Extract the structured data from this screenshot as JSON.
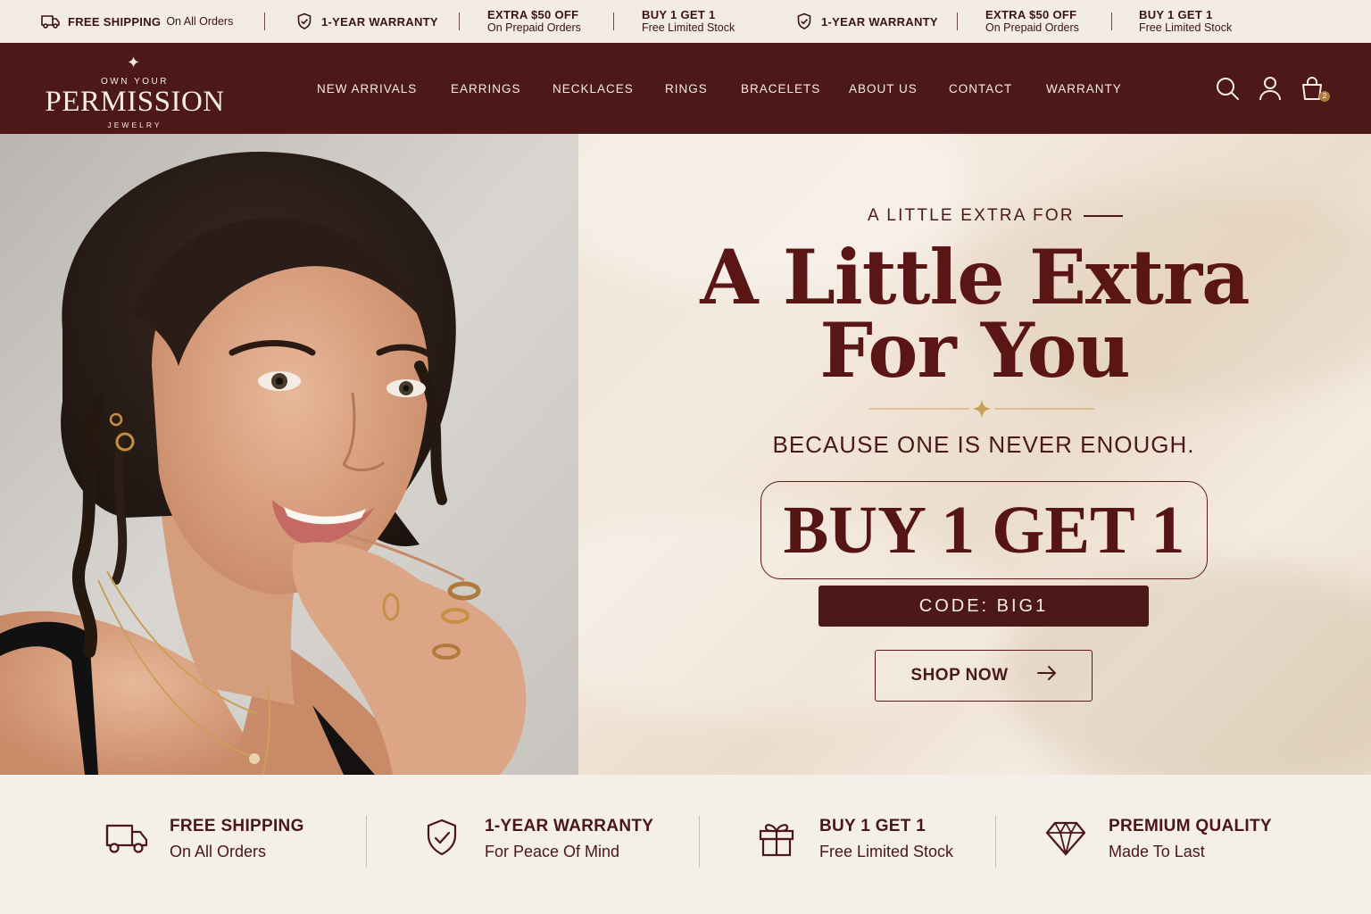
{
  "announcement_bar": {
    "items": [
      {
        "icon": "truck-icon",
        "title": "FREE SHIPPING",
        "sub": "On All Orders"
      },
      {
        "icon": "shield-check-icon",
        "title": "1-YEAR WARRANTY",
        "sub": ""
      },
      {
        "icon": "",
        "title": "EXTRA $50 OFF",
        "sub": "On Prepaid Orders"
      },
      {
        "icon": "",
        "title": "BUY 1 GET 1",
        "sub": "Free Limited Stock"
      },
      {
        "icon": "shield-check-icon",
        "title": "1-YEAR WARRANTY",
        "sub": ""
      },
      {
        "icon": "",
        "title": "EXTRA $50 OFF",
        "sub": "On Prepaid Orders"
      },
      {
        "icon": "",
        "title": "BUY 1 GET 1",
        "sub": "Free Limited Stock"
      }
    ]
  },
  "brand": {
    "top": "OWN YOUR",
    "name": "PERMISSION",
    "bottom": "JEWELRY"
  },
  "nav": {
    "items": [
      "NEW ARRIVALS",
      "EARRINGS",
      "NECKLACES",
      "RINGS",
      "BRACELETS",
      "ABOUT US",
      "CONTACT",
      "WARRANTY"
    ],
    "icons": [
      "search-icon",
      "account-icon",
      "cart-icon"
    ],
    "cart_count": "2"
  },
  "hero": {
    "eyebrow": "A LITTLE EXTRA FOR",
    "headline_line1": "A Little Extra",
    "headline_line2": "For You",
    "subhead": "BECAUSE ONE IS NEVER ENOUGH.",
    "offer": "BUY 1 GET 1",
    "code": "CODE: BIG1",
    "cta": "SHOP NOW"
  },
  "features": [
    {
      "icon": "truck-icon",
      "title": "FREE SHIPPING",
      "sub": "On All Orders"
    },
    {
      "icon": "shield-check-icon",
      "title": "1-YEAR WARRANTY",
      "sub": "For Peace Of Mind"
    },
    {
      "icon": "gift-icon",
      "title": "BUY 1 GET 1",
      "sub": "Free Limited Stock"
    },
    {
      "icon": "diamond-icon",
      "title": "PREMIUM QUALITY",
      "sub": "Made To Last"
    }
  ],
  "colors": {
    "brand_maroon": "#4d1818",
    "headline": "#5a1515",
    "cream": "#f4ede4",
    "gold_accent": "#c9a05a"
  }
}
